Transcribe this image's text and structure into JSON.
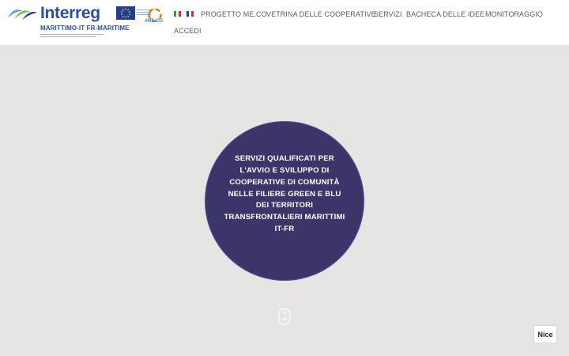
{
  "header": {
    "logo": {
      "wordmark": "Interreg",
      "program": "MARITTIMO-IT FR-MARITIME",
      "brand_color": "#2b4ea0"
    },
    "partner_logo": {
      "text": "#ME.CO",
      "color": "#3a8ec7"
    },
    "language_flags": [
      {
        "icon": "italy-flag-icon"
      },
      {
        "icon": "france-flag-icon"
      }
    ],
    "nav": [
      {
        "label": "PROGETTO ME.CO"
      },
      {
        "label": "VETRINA DELLE COOPERATIVE"
      },
      {
        "label": "SERVIZI"
      },
      {
        "label": "BACHECA DELLE IDEE"
      },
      {
        "label": "MONITORAGGIO"
      },
      {
        "label": "ACCEDI"
      }
    ]
  },
  "hero": {
    "text": "SERVIZI QUALIFICATI PER L'AVVIO E SVILUPPO DI COOPERATIVE DI COMUNITÀ NELLE FILIERE GREEN E BLU DEI TERRITORI TRANSFRONTALIERI MARITTIMI IT-FR",
    "circle_color": "#3b3569"
  },
  "scroll_hint": {
    "icon": "scroll-mouse-icon"
  },
  "map_label": {
    "text": "Nice"
  },
  "colors": {
    "background": "#e6e5e3",
    "nav_text": "#555b6e"
  }
}
